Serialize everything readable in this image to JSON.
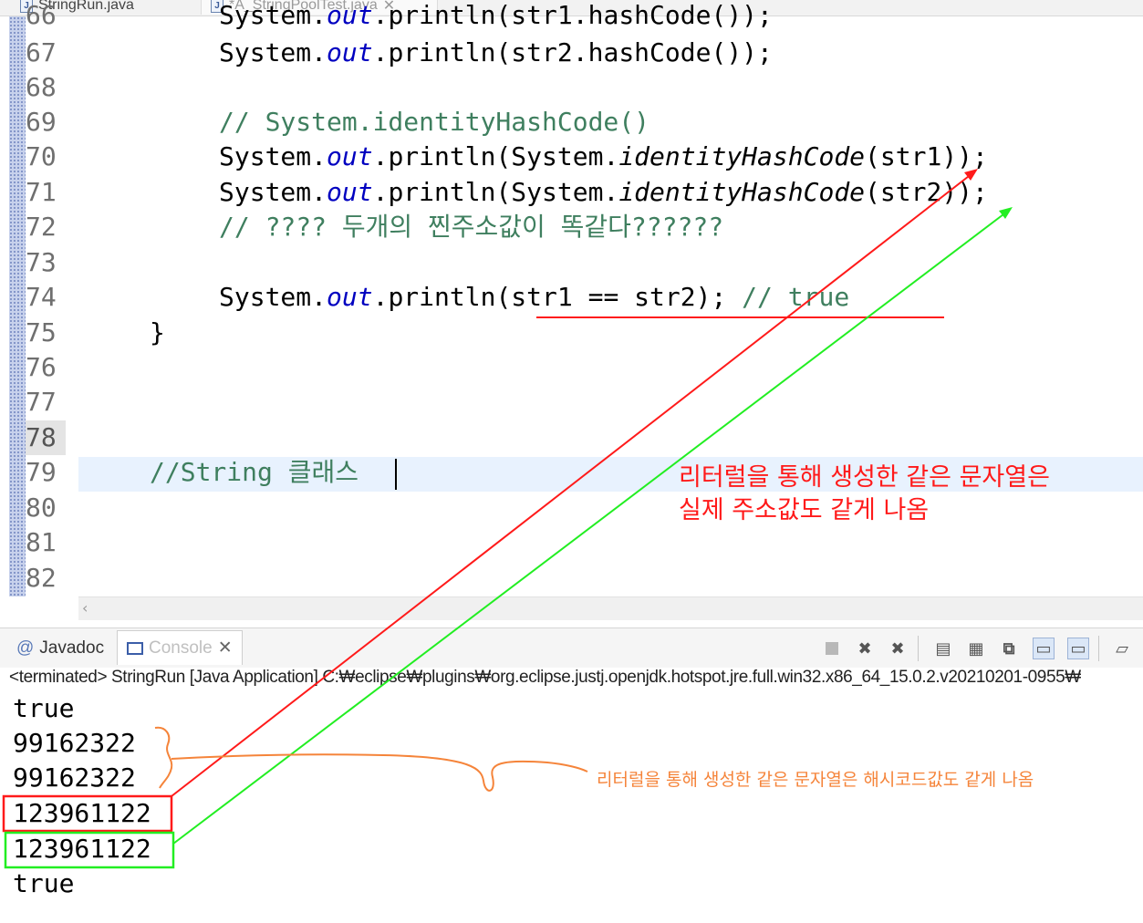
{
  "tabs": [
    {
      "label": "StringRun.java",
      "icon": "java-file-icon"
    },
    {
      "label": "*A_StringPoolTest.java",
      "icon": "java-file-icon",
      "close": "✕"
    }
  ],
  "editor": {
    "line_numbers": [
      "66",
      "67",
      "68",
      "69",
      "70",
      "71",
      "72",
      "73",
      "74",
      "75",
      "76",
      "77",
      "78",
      "79",
      "80",
      "81",
      "82"
    ],
    "lines": {
      "l66": {
        "a": "System.",
        "b": "out",
        "c": ".println(str1.hashCode());"
      },
      "l67": {
        "a": "System.",
        "b": "out",
        "c": ".println(str2.hashCode());"
      },
      "l69": "// System.identityHashCode()",
      "l70": {
        "a": "System.",
        "b": "out",
        "c": ".println(System.",
        "d": "identityHashCode",
        "e": "(str1));"
      },
      "l71": {
        "a": "System.",
        "b": "out",
        "c": ".println(System.",
        "d": "identityHashCode",
        "e": "(str2));"
      },
      "l72": "// ???? 두개의 찐주소값이 똑같다??????",
      "l74": {
        "a": "System.",
        "b": "out",
        "c": ".println(str1 == str2); ",
        "d": "// true"
      },
      "l75": "}",
      "l79": "//String 클래스"
    }
  },
  "console": {
    "tabs": {
      "javadoc": "Javadoc",
      "console": "Console",
      "close": "✕"
    },
    "status": "<terminated> StringRun [Java Application] C:₩eclipse₩plugins₩org.eclipse.justj.openjdk.hotspot.jre.full.win32.x86_64_15.0.2.v20210201-0955₩",
    "output": [
      "true",
      "99162322",
      "99162322",
      "123961122",
      "123961122",
      "true"
    ]
  },
  "annotations": {
    "red_note": [
      "리터럴을 통해 생성한 같은 문자열은",
      "실제 주소값도 같게 나옴"
    ],
    "orange_note": "리터럴을 통해 생성한 같은 문자열은 해시코드값도 같게 나옴",
    "colors": {
      "red": "#ff1a1a",
      "green": "#22ee22",
      "orange": "#f5843a"
    }
  }
}
